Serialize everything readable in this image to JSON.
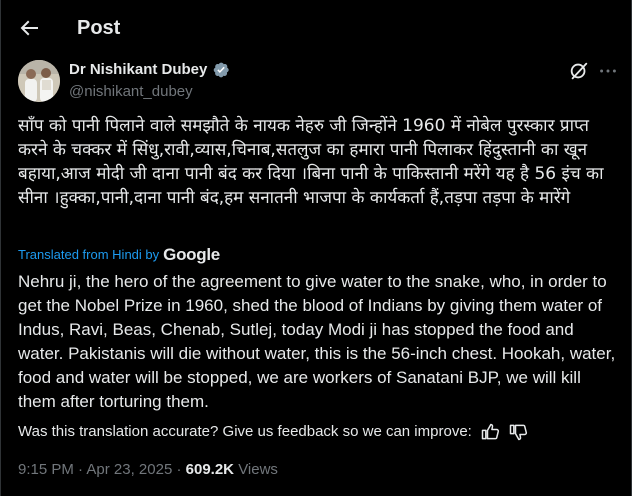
{
  "header": {
    "title": "Post"
  },
  "author": {
    "name": "Dr Nishikant Dubey",
    "handle": "@nishikant_dubey"
  },
  "post": {
    "original_text": "साँप को पानी पिलाने वाले समझौते के नायक नेहरु जी जिन्होंने 1960 में नोबेल पुरस्कार प्राप्त करने के चक्कर में सिंधु,रावी,व्यास,चिनाब,सतलुज का हमारा पानी पिलाकर हिंदुस्तानी का खून बहाया,आज मोदी जी दाना पानी बंद कर दिया ।बिना पानी के पाकिस्तानी मरेंगे यह है 56 इंच का सीना ।हुक्का,पानी,दाना पानी बंद,हम सनातनी भाजपा के कार्यकर्ता हैं,तड़पा तड़पा के मारेंगे",
    "translated_from": "Translated from Hindi by",
    "google": "Google",
    "translation": "Nehru ji, the hero of the agreement to give water to the snake, who, in order to get the Nobel Prize in 1960, shed the blood of Indians by giving them water of Indus, Ravi, Beas, Chenab, Sutlej, today Modi ji has stopped the food and water. Pakistanis will die without water, this is the 56-inch chest. Hookah, water, food and water will be stopped, we are workers of Sanatani BJP, we will kill them after torturing them.",
    "feedback_prompt": "Was this translation accurate? Give us feedback so we can improve:",
    "time": "9:15 PM",
    "date": "Apr 23, 2025",
    "separator": "·",
    "views_count": "609.2K",
    "views_label": "Views"
  },
  "icons": {
    "back": "arrow-left-icon",
    "verified": "verified-badge-icon",
    "grok": "grok-icon",
    "more": "more-horizontal-icon",
    "thumbs_up": "thumbs-up-icon",
    "thumbs_down": "thumbs-down-icon"
  },
  "colors": {
    "background": "#000000",
    "text": "#e7e9ea",
    "secondary": "#71767b",
    "accent": "#1d9bf0"
  }
}
